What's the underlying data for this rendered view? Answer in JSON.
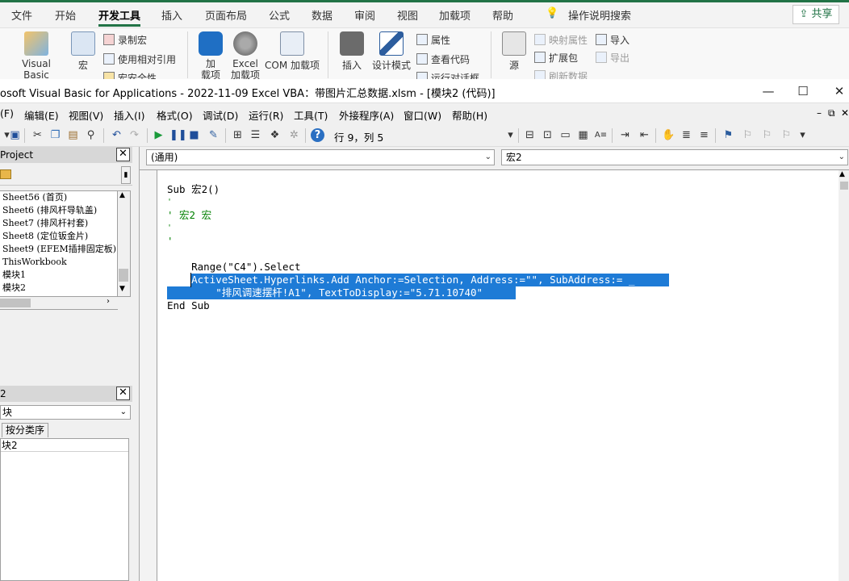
{
  "excel": {
    "tabs": [
      "文件",
      "开始",
      "开发工具",
      "插入",
      "页面布局",
      "公式",
      "数据",
      "审阅",
      "视图",
      "加载项",
      "帮助"
    ],
    "search": "操作说明搜索",
    "share": "共享",
    "ribbon": {
      "visual_basic": "Visual Basic",
      "macro": "宏",
      "record_macro": "录制宏",
      "relative_ref": "使用相对引用",
      "macro_security": "宏安全性",
      "addins": "加\n载项",
      "excel_addins": "Excel\n加载项",
      "com_addins": "COM 加载项",
      "insert": "插入",
      "design_mode": "设计模式",
      "properties": "属性",
      "view_code": "查看代码",
      "run_dialog": "运行对话框",
      "source": "源",
      "map_properties": "映射属性",
      "expansion_packs": "扩展包",
      "refresh_data": "刷新数据",
      "import": "导入",
      "export": "导出"
    }
  },
  "vbe": {
    "title": "osoft Visual Basic for Applications - 2022-11-09 Excel VBA：带图片汇总数据.xlsm - [模块2 (代码)]",
    "menu": [
      "(F)",
      "编辑(E)",
      "视图(V)",
      "插入(I)",
      "格式(O)",
      "调试(D)",
      "运行(R)",
      "工具(T)",
      "外接程序(A)",
      "窗口(W)",
      "帮助(H)"
    ],
    "position": "行 9，列 5",
    "project": {
      "header": "Project",
      "items": [
        "Sheet56 (首页)",
        "Sheet6 (排风杆导轨盖)",
        "Sheet7 (排风杆衬套)",
        "Sheet8 (定位钣金片)",
        "Sheet9 (EFEM插排固定板)",
        "ThisWorkbook",
        "模块1",
        "模块2"
      ]
    },
    "properties": {
      "header": "2",
      "select": "块",
      "tab": "按分类序",
      "row": "块2"
    },
    "code": {
      "object_combo": "(通用)",
      "proc_combo": "宏2",
      "lines": {
        "l1": "Sub 宏2()",
        "l2": "'",
        "l3": "' 宏2 宏",
        "l4": "'",
        "l5": "'",
        "l6": "    Range(\"C4\").Select",
        "l7": "    ActiveSheet.Hyperlinks.Add Anchor:=Selection, Address:=\"\", SubAddress:= _",
        "l8": "        \"排风调速摆杆!A1\", TextToDisplay:=\"5.71.10740\"",
        "l9": "End Sub"
      }
    }
  }
}
